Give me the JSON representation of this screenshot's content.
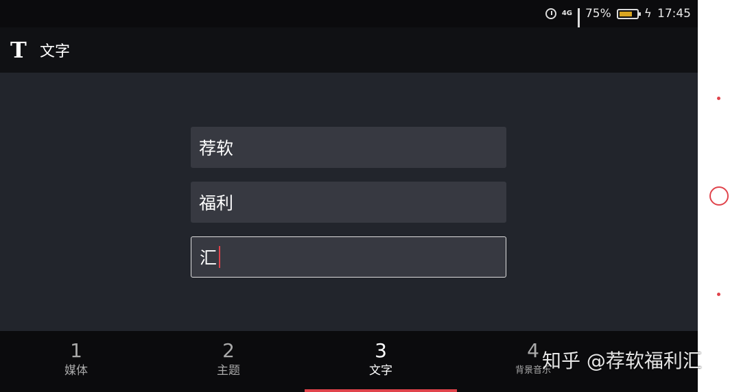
{
  "status_bar": {
    "network": "4G",
    "battery": "75%",
    "battery_level": 0.75,
    "time": "17:45"
  },
  "header": {
    "icon": "T",
    "title": "文字"
  },
  "fields": [
    {
      "value": "荐软"
    },
    {
      "value": "福利"
    },
    {
      "value": "汇"
    }
  ],
  "tabs": [
    {
      "number": "1",
      "label": "媒体"
    },
    {
      "number": "2",
      "label": "主题"
    },
    {
      "number": "3",
      "label": "文字"
    },
    {
      "number": "4",
      "label": "背景音乐"
    }
  ],
  "watermark": {
    "text": "知乎 @荐软福利汇"
  },
  "colors": {
    "accent": "#e0434b",
    "background": "#22252c",
    "field": "#373941"
  }
}
